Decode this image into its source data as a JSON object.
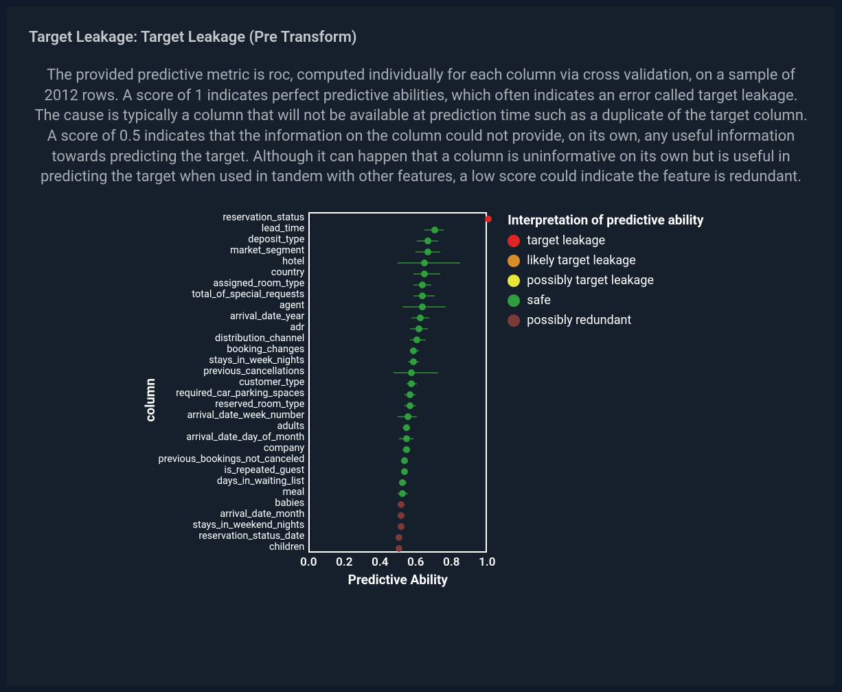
{
  "title": "Target Leakage: Target Leakage (Pre Transform)",
  "description": "The provided predictive metric is roc, computed individually for each column via cross validation, on a sample of 2012 rows. A score of 1 indicates perfect predictive abilities, which often indicates an error called target leakage. The cause is typically a column that will not be available at prediction time such as a duplicate of the target column. A score of 0.5 indicates that the information on the column could not provide, on its own, any useful information towards predicting the target. Although it can happen that a column is uninformative on its own but is useful in predicting the target when used in tandem with other features, a low score could indicate the feature is redundant.",
  "chart_data": {
    "type": "scatter",
    "title": "",
    "xlabel": "Predictive Ability",
    "ylabel": "column",
    "xlim": [
      0.0,
      1.0
    ],
    "xticks": [
      0.0,
      0.2,
      0.4,
      0.6,
      0.8,
      1.0
    ],
    "legend_title": "Interpretation of predictive ability",
    "legend": [
      {
        "name": "target leakage",
        "color": "#e02424"
      },
      {
        "name": "likely target leakage",
        "color": "#d98c2b"
      },
      {
        "name": "possibly target leakage",
        "color": "#e7e73a"
      },
      {
        "name": "safe",
        "color": "#2e9e3f"
      },
      {
        "name": "possibly redundant",
        "color": "#7a3a3a"
      }
    ],
    "rows": [
      {
        "label": "reservation_status",
        "value": 1.0,
        "low": 1.0,
        "high": 1.0,
        "cat": "target leakage"
      },
      {
        "label": "lead_time",
        "value": 0.7,
        "low": 0.64,
        "high": 0.75,
        "cat": "safe"
      },
      {
        "label": "deposit_type",
        "value": 0.66,
        "low": 0.6,
        "high": 0.72,
        "cat": "safe"
      },
      {
        "label": "market_segment",
        "value": 0.66,
        "low": 0.59,
        "high": 0.73,
        "cat": "safe"
      },
      {
        "label": "hotel",
        "value": 0.64,
        "low": 0.49,
        "high": 0.84,
        "cat": "safe"
      },
      {
        "label": "country",
        "value": 0.64,
        "low": 0.58,
        "high": 0.73,
        "cat": "safe"
      },
      {
        "label": "assigned_room_type",
        "value": 0.63,
        "low": 0.58,
        "high": 0.68,
        "cat": "safe"
      },
      {
        "label": "total_of_special_requests",
        "value": 0.63,
        "low": 0.58,
        "high": 0.7,
        "cat": "safe"
      },
      {
        "label": "agent",
        "value": 0.63,
        "low": 0.52,
        "high": 0.76,
        "cat": "safe"
      },
      {
        "label": "arrival_date_year",
        "value": 0.62,
        "low": 0.57,
        "high": 0.67,
        "cat": "safe"
      },
      {
        "label": "adr",
        "value": 0.61,
        "low": 0.56,
        "high": 0.66,
        "cat": "safe"
      },
      {
        "label": "distribution_channel",
        "value": 0.6,
        "low": 0.56,
        "high": 0.65,
        "cat": "safe"
      },
      {
        "label": "booking_changes",
        "value": 0.58,
        "low": 0.56,
        "high": 0.61,
        "cat": "safe"
      },
      {
        "label": "stays_in_week_nights",
        "value": 0.58,
        "low": 0.55,
        "high": 0.61,
        "cat": "safe"
      },
      {
        "label": "previous_cancellations",
        "value": 0.57,
        "low": 0.47,
        "high": 0.72,
        "cat": "safe"
      },
      {
        "label": "customer_type",
        "value": 0.57,
        "low": 0.54,
        "high": 0.6,
        "cat": "safe"
      },
      {
        "label": "required_car_parking_spaces",
        "value": 0.56,
        "low": 0.53,
        "high": 0.59,
        "cat": "safe"
      },
      {
        "label": "reserved_room_type",
        "value": 0.56,
        "low": 0.53,
        "high": 0.59,
        "cat": "safe"
      },
      {
        "label": "arrival_date_week_number",
        "value": 0.55,
        "low": 0.49,
        "high": 0.6,
        "cat": "safe"
      },
      {
        "label": "adults",
        "value": 0.54,
        "low": 0.52,
        "high": 0.56,
        "cat": "safe"
      },
      {
        "label": "arrival_date_day_of_month",
        "value": 0.54,
        "low": 0.5,
        "high": 0.58,
        "cat": "safe"
      },
      {
        "label": "company",
        "value": 0.54,
        "low": 0.52,
        "high": 0.56,
        "cat": "safe"
      },
      {
        "label": "previous_bookings_not_canceled",
        "value": 0.53,
        "low": 0.51,
        "high": 0.55,
        "cat": "safe"
      },
      {
        "label": "is_repeated_guest",
        "value": 0.53,
        "low": 0.51,
        "high": 0.55,
        "cat": "safe"
      },
      {
        "label": "days_in_waiting_list",
        "value": 0.52,
        "low": 0.5,
        "high": 0.54,
        "cat": "safe"
      },
      {
        "label": "meal",
        "value": 0.52,
        "low": 0.49,
        "high": 0.55,
        "cat": "safe"
      },
      {
        "label": "babies",
        "value": 0.51,
        "low": 0.5,
        "high": 0.52,
        "cat": "possibly redundant"
      },
      {
        "label": "arrival_date_month",
        "value": 0.51,
        "low": 0.49,
        "high": 0.53,
        "cat": "possibly redundant"
      },
      {
        "label": "stays_in_weekend_nights",
        "value": 0.51,
        "low": 0.49,
        "high": 0.53,
        "cat": "possibly redundant"
      },
      {
        "label": "reservation_status_date",
        "value": 0.5,
        "low": 0.48,
        "high": 0.52,
        "cat": "possibly redundant"
      },
      {
        "label": "children",
        "value": 0.5,
        "low": 0.48,
        "high": 0.52,
        "cat": "possibly redundant"
      }
    ]
  }
}
